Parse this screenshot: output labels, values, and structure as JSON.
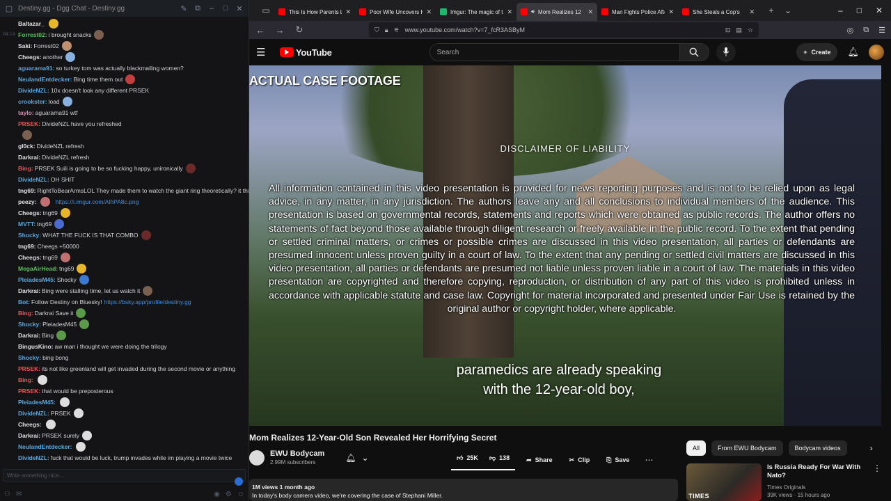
{
  "chat": {
    "window_title": "Destiny.gg - Dgg Chat - Destiny.gg",
    "input_placeholder": "Write something nice...",
    "messages": [
      {
        "ts": "",
        "user": "Baltazar_",
        "color": "#e0e0e0",
        "text": "",
        "emote": "#e7b62a"
      },
      {
        "ts": "04:14",
        "user": "Forrest02:",
        "color": "#5bbf5b",
        "text": "i brought snacks",
        "emote": "#7a6050"
      },
      {
        "ts": "",
        "user": "Saki:",
        "color": "#e0e0e0",
        "text": "Forrest02",
        "emote": "#c09070"
      },
      {
        "ts": "",
        "user": "Cheegs:",
        "color": "#e0e0e0",
        "text": "another",
        "emote": "#8ab0e0"
      },
      {
        "ts": "",
        "user": "aguarama91:",
        "color": "#58a8e0",
        "text": "so turkey tom was actually blackmailing women?",
        "emote": ""
      },
      {
        "ts": "",
        "user": "NeulandEntdecker:",
        "color": "#58a8e0",
        "text": "Bing time them out",
        "emote": "#c04040"
      },
      {
        "ts": "",
        "user": "DivideNZL:",
        "color": "#58a8e0",
        "text": "10x doesn't look any different PRSEK",
        "emote": ""
      },
      {
        "ts": "",
        "user": "crookster:",
        "color": "#58a8e0",
        "text": "load",
        "emote": "#8ab0e0"
      },
      {
        "ts": "",
        "user": "taylo:",
        "color": "#e088b0",
        "text": "aguarama91 wtf",
        "emote": ""
      },
      {
        "ts": "",
        "user": "PRSEK:",
        "color": "#e05858",
        "text": "DivideNZL have you refreshed",
        "emote": ""
      },
      {
        "ts": "",
        "user": "",
        "color": "#e0e0e0",
        "text": "",
        "emote": "#7a6050"
      },
      {
        "ts": "",
        "user": "gl0ck:",
        "color": "#e0e0e0",
        "text": "DivideNZL refresh",
        "emote": ""
      },
      {
        "ts": "",
        "user": "Darkrai:",
        "color": "#e0e0e0",
        "text": "DivideNZL refresh",
        "emote": ""
      },
      {
        "ts": "",
        "user": "Bing:",
        "color": "#e05858",
        "text": "PRSEK Suili is going to be so fucking happy, unironically",
        "emote": "#6a2a2a"
      },
      {
        "ts": "",
        "user": "DivideNZL:",
        "color": "#58a8e0",
        "text": "OH SHIT",
        "emote": ""
      },
      {
        "ts": "",
        "user": "tng69:",
        "color": "#e0e0e0",
        "text": "RightToBearArmsLOL They made them to watch the giant ring theoretically? it this?",
        "emote": ""
      },
      {
        "ts": "",
        "user": "peezy:",
        "color": "#e0e0e0",
        "text": "",
        "link": "https://i.imgur.com/AlhPA8c.png",
        "emote": "#c07070"
      },
      {
        "ts": "",
        "user": "Cheegs:",
        "color": "#e0e0e0",
        "text": "tng69",
        "emote": "#e7b62a"
      },
      {
        "ts": "",
        "user": "MVTT:",
        "color": "#58a8e0",
        "text": "tng69",
        "emote": "#4a6ad0"
      },
      {
        "ts": "",
        "user": "Shocky:",
        "color": "#58a8e0",
        "text": "WHAT THE FUCK IS THAT COMBO",
        "emote": "#6a2a2a"
      },
      {
        "ts": "",
        "user": "tng69:",
        "color": "#e0e0e0",
        "text": "Cheegs +50000",
        "emote": ""
      },
      {
        "ts": "",
        "user": "Cheegs:",
        "color": "#e0e0e0",
        "text": "tng69",
        "emote": "#c07070"
      },
      {
        "ts": "",
        "user": "MegaAirHead:",
        "color": "#5bbf5b",
        "text": "tng69",
        "emote": "#e7b62a"
      },
      {
        "ts": "",
        "user": "PleiadesM45:",
        "color": "#58a8e0",
        "text": "Shocky",
        "emote": "#3a7ad0"
      },
      {
        "ts": "",
        "user": "Darkrai:",
        "color": "#e0e0e0",
        "text": "Bing were stalling time, let us watch it",
        "emote": "#7a6050"
      },
      {
        "ts": "",
        "user": "Bot:",
        "color": "#58a8e0",
        "text": "Follow Destiny on Bluesky!",
        "link": "https://bsky.app/profile/destiny.gg",
        "emote": ""
      },
      {
        "ts": "",
        "user": "Bing:",
        "color": "#e05858",
        "text": "Darkrai Save it",
        "emote": "#5a9a4a"
      },
      {
        "ts": "",
        "user": "Shocky:",
        "color": "#58a8e0",
        "text": "PleiadesM45",
        "emote": "#5a9a4a"
      },
      {
        "ts": "",
        "user": "Darkrai:",
        "color": "#e0e0e0",
        "text": "Bing",
        "emote": "#5a9a4a"
      },
      {
        "ts": "",
        "user": "BingusKino:",
        "color": "#e0e0e0",
        "text": "aw man i thought we were doing the trilogy",
        "emote": ""
      },
      {
        "ts": "",
        "user": "Shocky:",
        "color": "#58a8e0",
        "text": "bing bong",
        "emote": ""
      },
      {
        "ts": "",
        "user": "PRSEK:",
        "color": "#e05858",
        "text": "its not like greenland will get invaded during the second movie or anything",
        "emote": ""
      },
      {
        "ts": "",
        "user": "Bing:",
        "color": "#e05858",
        "text": "",
        "emote": "#dddddd"
      },
      {
        "ts": "",
        "user": "PRSEK:",
        "color": "#e05858",
        "text": "that would be preposterous",
        "emote": ""
      },
      {
        "ts": "",
        "user": "PleiadesM45:",
        "color": "#58a8e0",
        "text": "",
        "emote": "#dddddd"
      },
      {
        "ts": "",
        "user": "DivideNZL:",
        "color": "#58a8e0",
        "text": "PRSEK",
        "emote": "#dddddd"
      },
      {
        "ts": "",
        "user": "Cheegs:",
        "color": "#e0e0e0",
        "text": "",
        "emote": "#dddddd"
      },
      {
        "ts": "",
        "user": "Darkrai:",
        "color": "#e0e0e0",
        "text": "PRSEK surely",
        "emote": "#dddddd"
      },
      {
        "ts": "",
        "user": "NeulandEntdecker:",
        "color": "#58a8e0",
        "text": "",
        "emote": "#dddddd"
      },
      {
        "ts": "",
        "user": "DivideNZL:",
        "color": "#58a8e0",
        "text": "fuck that would be luck, trump invades while im playing a movie twice",
        "emote": ""
      }
    ]
  },
  "browser": {
    "tabs": [
      {
        "label": "This Is How Parents Le",
        "color": "#ff0000"
      },
      {
        "label": "Poor Wife Uncovers H",
        "color": "#ff0000"
      },
      {
        "label": "Imgur: The magic of th",
        "color": "#1bb76e"
      },
      {
        "label": "Mom Realizes 12",
        "color": "#ff0000",
        "active": true
      },
      {
        "label": "Man Fights Police Afte",
        "color": "#ff0000"
      },
      {
        "label": "She Steals a Cop's",
        "color": "#ff0000"
      }
    ],
    "url": "www.youtube.com/watch?v=7_fcR3ASByM"
  },
  "youtube": {
    "logo_text": "YouTube",
    "search_placeholder": "Search",
    "create_label": "Create"
  },
  "video": {
    "footage_label": "ACTUAL CASE FOOTAGE",
    "disclaimer_title": "DISCLAIMER OF LIABILITY",
    "disclaimer_body": "All information contained in this video presentation is provided for news reporting purposes and is not to be relied upon as legal advice, in any matter, in any jurisdiction. The authors leave any and all conclusions to individual members of the audience. This presentation is based on governmental records, statements and reports which were obtained as public records. The author offers no statements of fact beyond those available through diligent research or freely available in the public record. To the extent that pending or settled criminal matters, or crimes or possible crimes are discussed in this video presentation, all parties or defendants are presumed innocent unless proven guilty in a court of law. To the extent that any pending or settled civil matters are discussed in this video presentation, all parties or defendants are presumed not liable unless proven liable in a court of law. The materials in this video presentation are copyrighted and therefore copying, reproduction, or distribution of any part of this video is prohibited unless in accordance with applicable statute and case law. Copyright for material incorporated and presented under Fair Use is retained by the original author or copyright holder, where applicable.",
    "caption_line1": "paramedics are already speaking",
    "caption_line2": "with the 12-year-old boy,",
    "title": "Mom Realizes 12-Year-Old Son Revealed Her Horrifying Secret",
    "channel_name": "EWU Bodycam",
    "subscribers": "2.99M subscribers",
    "likes": "25K",
    "dislikes": "138",
    "share_label": "Share",
    "clip_label": "Clip",
    "save_label": "Save",
    "stats": "1M views  1 month ago",
    "description": "In today's body camera video, we're covering the case of Stephani Miller."
  },
  "sidebar": {
    "chips": [
      "All",
      "From EWU Bodycam",
      "Bodycam videos"
    ],
    "rec": {
      "title": "Is Russia Ready For War With Nato?",
      "channel": "Times Originals",
      "meta": "39K views · 15 hours ago",
      "thumb_brand": "TIMES"
    }
  }
}
